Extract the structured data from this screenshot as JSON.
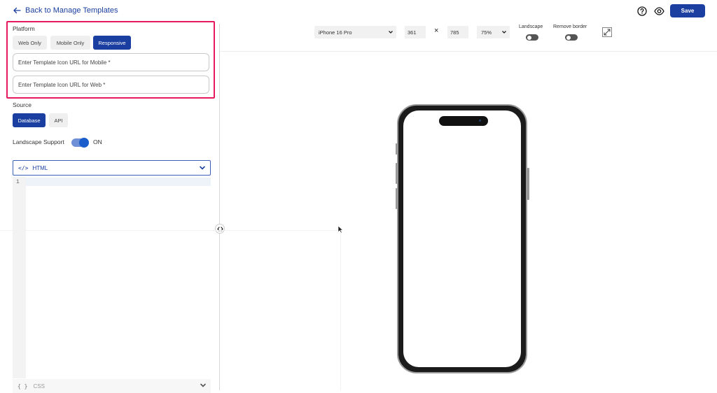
{
  "header": {
    "back_label": "Back to Manage Templates",
    "save_label": "Save",
    "accent_color": "#1a3fa0"
  },
  "platform": {
    "label": "Platform",
    "options": [
      "Web Only",
      "Mobile Only",
      "Responsive"
    ],
    "selected": "Responsive",
    "mobile_icon_placeholder": "Enter Template Icon URL for Mobile *",
    "web_icon_placeholder": "Enter Template Icon URL for Web *",
    "highlight_color": "#e6195c"
  },
  "source": {
    "label": "Source",
    "options": [
      "Database",
      "API"
    ],
    "selected": "Database"
  },
  "landscape_support": {
    "label": "Landscape Support",
    "state": "ON"
  },
  "editor": {
    "html_tab_icon": "</>",
    "html_tab_label": "HTML",
    "line_numbers": [
      "1"
    ],
    "css_tab_icon": "{ }",
    "css_tab_label": "CSS"
  },
  "preview": {
    "device": "iPhone 16 Pro",
    "width": "361",
    "times": "×",
    "height": "785",
    "zoom": "75%",
    "landscape_label": "Landscape",
    "remove_border_label": "Remove border"
  }
}
